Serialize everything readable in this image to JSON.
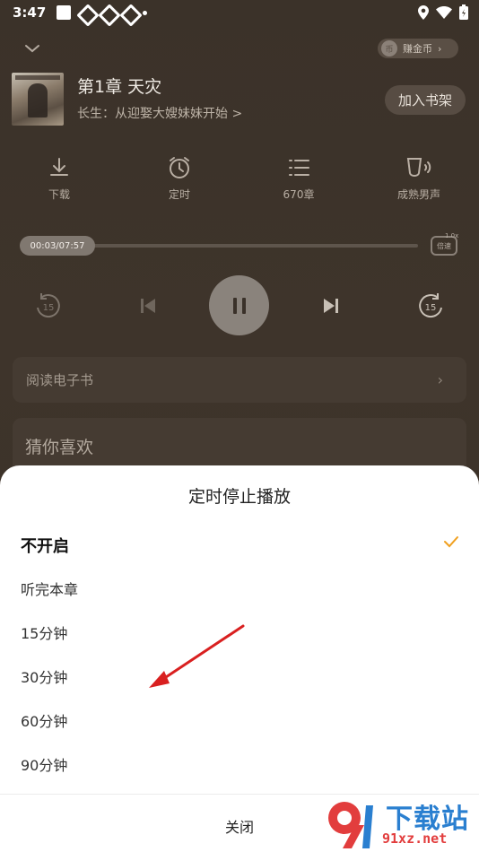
{
  "status_bar": {
    "time": "3:47"
  },
  "header": {
    "coin_label": "赚金币",
    "coin_icon": "币"
  },
  "book": {
    "chapter_title": "第1章 天灾",
    "book_link": "长生：从迎娶大嫂妹妹开始 >",
    "shelf_button": "加入书架"
  },
  "tools": [
    {
      "icon": "download-icon",
      "label": "下载"
    },
    {
      "icon": "alarm-clock-icon",
      "label": "定时"
    },
    {
      "icon": "list-icon",
      "label": "670章"
    },
    {
      "icon": "voice-icon",
      "label": "成熟男声"
    }
  ],
  "progress": {
    "time": "00:03/07:57",
    "fraction": 0.006,
    "speed_label": "倍速",
    "speed_value": "1.0x"
  },
  "controls": {
    "rewind": "15",
    "forward": "15"
  },
  "ebook_row": {
    "label": "阅读电子书"
  },
  "guess": {
    "title": "猜你喜欢"
  },
  "sheet": {
    "title": "定时停止播放",
    "options": [
      {
        "label": "不开启",
        "selected": true
      },
      {
        "label": "听完本章",
        "selected": false
      },
      {
        "label": "15分钟",
        "selected": false
      },
      {
        "label": "30分钟",
        "selected": false
      },
      {
        "label": "60分钟",
        "selected": false
      },
      {
        "label": "90分钟",
        "selected": false
      }
    ],
    "close": "关闭"
  },
  "watermark": {
    "text": "下载站",
    "url": "91xz.net"
  },
  "colors": {
    "accent": "#f0a020",
    "annotation": "#d92020"
  }
}
